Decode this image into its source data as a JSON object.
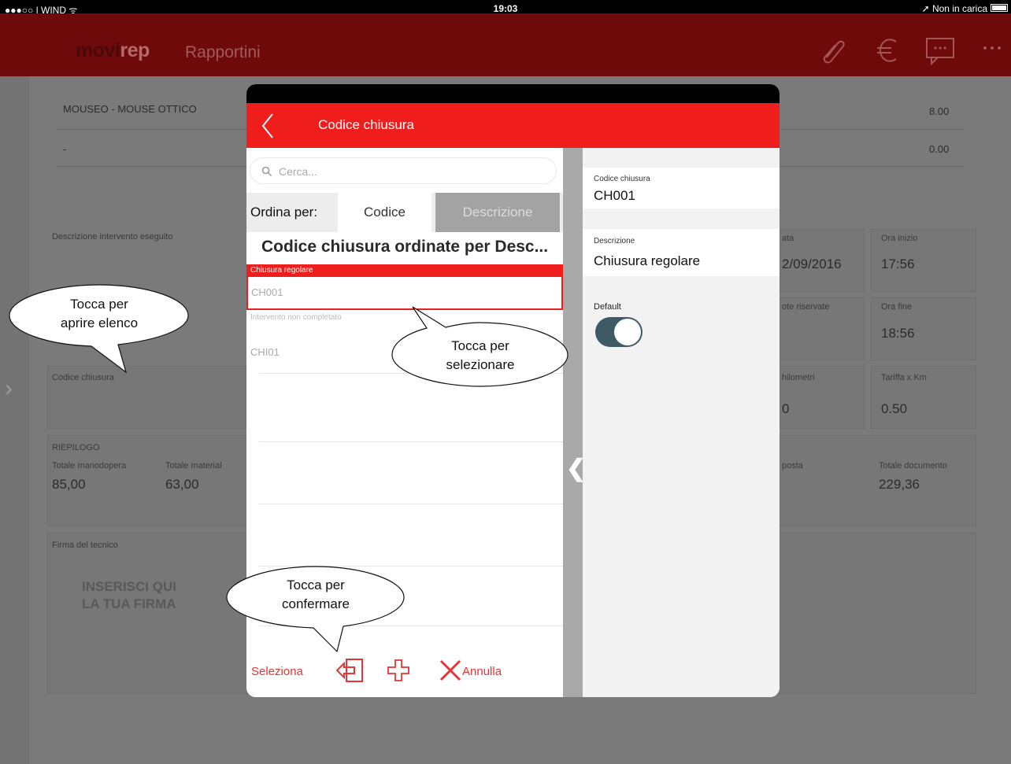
{
  "status_bar": {
    "carrier": "●●●○○ | WIND ᯤ",
    "time": "19:03",
    "battery_status": "➚ Non in carica"
  },
  "app_header": {
    "logo_part1": "movi",
    "logo_part2": "rep",
    "section": "Rapportini",
    "icons": [
      "paperclip-icon",
      "euro-icon",
      "chat-icon",
      "more-icon"
    ]
  },
  "background_page": {
    "rows": [
      {
        "item": "MOUSEO - MOUSE OTTICO",
        "value": "8.00"
      },
      {
        "item": "-",
        "value": "0.00"
      }
    ],
    "descrizione_label": "Descrizione intervento eseguito",
    "data_label": "ata",
    "data_value": "2/09/2016",
    "ora_inizio_label": "Ora inizio",
    "ora_inizio_value": "17:56",
    "note_label": "ote riservate",
    "ora_fine_label": "Ora fine",
    "ora_fine_value": "18:56",
    "codice_chiusura_label": "Codice chiusura",
    "km_label": "hilometri",
    "km_value": "0",
    "tariffa_label": "Tariffa x Km",
    "tariffa_value": "0.50",
    "riepilogo_label": "RIEPILOGO",
    "totale_manodopera_label": "Totale manodopera",
    "totale_manodopera_value": "85,00",
    "totale_materiali_label": "Totale material",
    "totale_materiali_value": "63,00",
    "imposta_label": "posta",
    "totale_documento_label": "Totale documento",
    "totale_documento_value": "229,36",
    "firma_label": "Firma del tecnico",
    "firma_line1": "INSERISCI QUI",
    "firma_line2": "LA TUA FIRMA"
  },
  "modal": {
    "title": "Codice chiusura",
    "search_placeholder": "Cerca...",
    "sort_label": "Ordina per:",
    "sort_options": [
      "Codice",
      "Descrizione"
    ],
    "sort_selected": "Descrizione",
    "list_title": "Codice chiusura ordinate per Desc...",
    "groups": [
      {
        "header": "Chiusura regolare",
        "code": "CH001",
        "selected": true
      },
      {
        "header": "Intervento non completato",
        "code": "CHI01",
        "selected": false
      }
    ],
    "toolbar": {
      "select_label": "Seleziona",
      "cancel_label": "Annulla"
    },
    "detail": {
      "code_label": "Codice chiusura",
      "code_value": "CH001",
      "desc_label": "Descrizione",
      "desc_value": "Chiusura regolare",
      "default_label": "Default",
      "default_on": true
    }
  },
  "callouts": {
    "open_list_line1": "Tocca per",
    "open_list_line2": "aprire elenco",
    "select_line1": "Tocca per",
    "select_line2": "selezionare",
    "confirm_line1": "Tocca per",
    "confirm_line2": "confermare"
  },
  "colors": {
    "accent_red": "#f01d1d",
    "header_dark_red": "#6e0a0a",
    "toggle_on": "#3d5a66"
  }
}
